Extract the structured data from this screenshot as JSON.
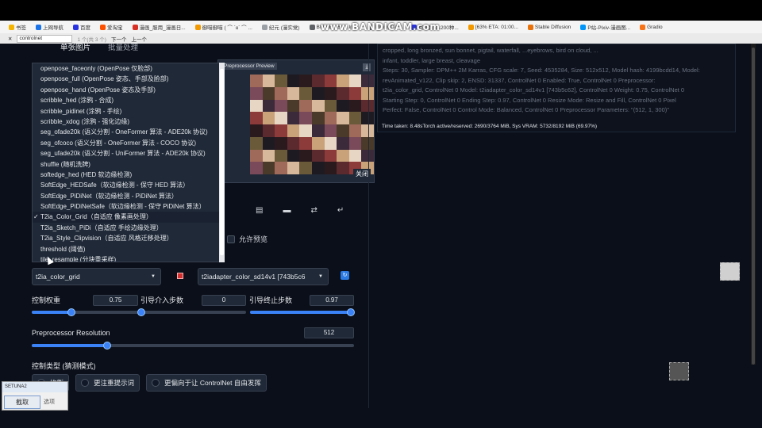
{
  "browser": {
    "bookmarks": [
      {
        "label": "书签",
        "color": "#f4b400"
      },
      {
        "label": "上网导航",
        "color": "#1a73e8"
      },
      {
        "label": "百度",
        "color": "#2932e1"
      },
      {
        "label": "爱淘宝",
        "color": "#ff5000"
      },
      {
        "label": "漫画_服用_漫画日...",
        "color": "#d93025"
      },
      {
        "label": "御喵御喵 ( ⌒ `ɞ´ ⌒ ...",
        "color": "#f29900"
      },
      {
        "label": "纪元 (漫实党)",
        "color": "#9aa0a6"
      },
      {
        "label": "BIRME - Bulk Im...",
        "color": "#5f6368"
      },
      {
        "label": "PromptTool",
        "color": "#5f6368"
      },
      {
        "label": "百度翻译-200种...",
        "color": "#2932e1"
      },
      {
        "label": "[63% ETA: 01:00...",
        "color": "#f29900"
      },
      {
        "label": "Stable Diffusion",
        "color": "#e8710a"
      },
      {
        "label": "P站-Pixiv-漫画图...",
        "color": "#0096fa"
      },
      {
        "label": "Gradio",
        "color": "#f97316"
      }
    ],
    "watermark": "www.BANDICAM.com",
    "find": {
      "query": "controlnet",
      "count": "1 个(共 3 个)",
      "down": "下一个",
      "up": "上一个"
    }
  },
  "left": {
    "tabs": [
      "单张图片",
      "批量处理"
    ],
    "preview_label": "Preprocessor Preview",
    "close_label": "关闭",
    "allow_preview": "允许预览",
    "preprocessor_options": [
      "openpose_faceonly (OpenPose 仅脸部)",
      "openpose_full (OpenPose 姿态、手部及脸部)",
      "openpose_hand (OpenPose 姿态及手部)",
      "scribble_hed (涂鸦 - 合成)",
      "scribble_pidinet (涂鸦 - 手绘)",
      "scribble_xdog (涂鸦 - 强化边缘)",
      "seg_ofade20k (语义分割 - OneFormer 算法 - ADE20k 协议)",
      "seg_ofcoco (语义分割 - OneFormer 算法 - COCO 协议)",
      "seg_ufade20k (语义分割 - UniFormer 算法 - ADE20k 协议)",
      "shuffle (随机洗牌)",
      "softedge_hed (HED 软边缘检测)",
      "SoftEdge_HEDSafe（软边缘检测 - 保守 HED 算法）",
      "SoftEdge_PiDiNet（软边缘检测 - PiDiNet 算法）",
      "SoftEdge_PiDiNetSafe（软边缘检测 - 保守 PiDiNet 算法）",
      "T2ia_Color_Grid（自适应 像素画处理）",
      "T2ia_Sketch_PiDi（自适应 手绘边缘处理）",
      "T2ia_Style_Clipvision（自适应 风格迁移处理）",
      "threshold (阈值)",
      "tile_resample (分块重采样)"
    ],
    "selected_index": 14,
    "preprocessor_value": "t2ia_color_grid",
    "model_value": "t2iadapter_color_sd14v1 [743b5c6",
    "control_weight": {
      "label": "控制权重",
      "value": "0.75",
      "fraction": 0.375
    },
    "guidance_start": {
      "label": "引导介入步数",
      "value": "0",
      "fraction": 0.0
    },
    "guidance_end": {
      "label": "引导终止步数",
      "value": "0.97",
      "fraction": 0.97
    },
    "preproc_resolution": {
      "label": "Preprocessor Resolution",
      "value": "512",
      "fraction": 0.235
    },
    "control_mode": {
      "label": "控制类型 (猜测模式)",
      "options": [
        "均衡",
        "更注重提示词",
        "更偏向于让 ControlNet 自由发挥"
      ]
    }
  },
  "right": {
    "info_lines": [
      "cropped, long bronzed, sun bonnet, pigtail, waterfall, ...eyebrows, bird on cloud, ...",
      "infant, toddler, large breast, cleavage",
      "Steps: 30, Sampler: DPM++ 2M Karras, CFG scale: 7, Seed: 4535284, Size: 512x512, Model hash: 4199bcdd14, Model:",
      "revAnimated_v122, Clip skip: 2, ENSD: 31337, ControlNet 0 Enabled: True, ControlNet 0 Preprocessor:",
      "t2ia_color_grid, ControlNet 0 Model: t2iadapter_color_sd14v1 [743b5c62], ControlNet 0 Weight: 0.75, ControlNet 0",
      "Starting Step: 0, ControlNet 0 Ending Step: 0.97, ControlNet 0 Resize Mode: Resize and Fill, ControlNet 0 Pixel",
      "Perfect: False, ControlNet 0 Control Mode: Balanced, ControlNet 0 Preprocessor Parameters: \"(512, 1, 300)\""
    ],
    "time_taken": "Time taken: 8.48sTorch active/reserved: 2690/3764 MiB, Sys VRAM: 5732/8192 MiB (69.97%)"
  },
  "setuna": {
    "title": "SETUNA2",
    "capture": "截取",
    "option": "选项"
  },
  "colors": {
    "accent": "#3b82f6",
    "panel": "#1f2937",
    "background": "#0b0f19"
  }
}
